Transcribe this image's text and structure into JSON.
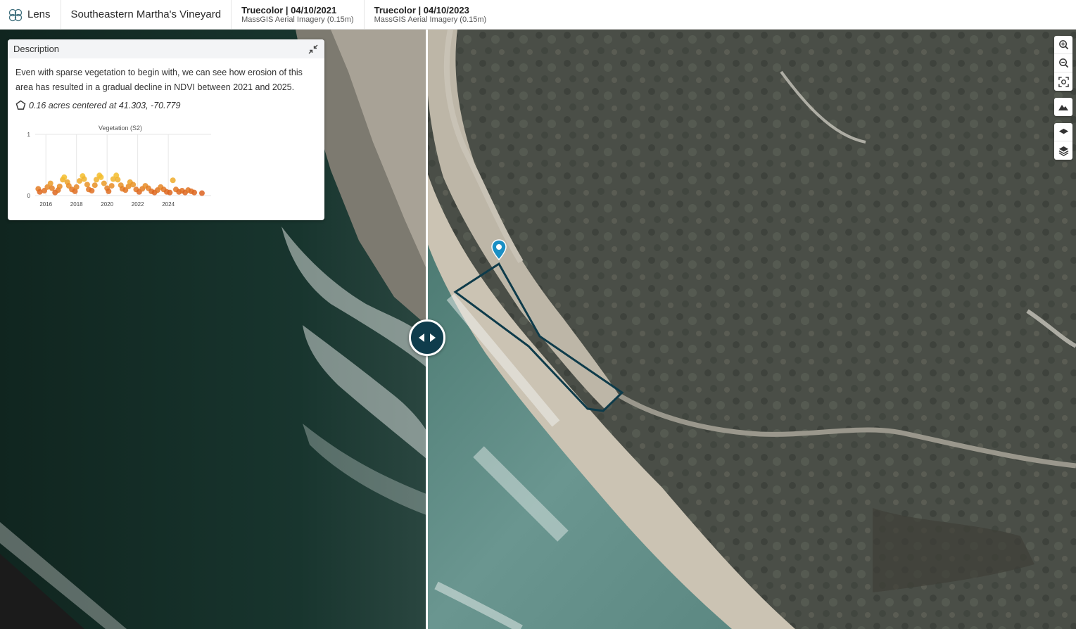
{
  "app": {
    "name": "Lens"
  },
  "project": {
    "title": "Southeastern Martha's Vineyard"
  },
  "layers": [
    {
      "title": "Truecolor | 04/10/2021",
      "source": "MassGIS Aerial Imagery (0.15m)"
    },
    {
      "title": "Truecolor | 04/10/2023",
      "source": "MassGIS Aerial Imagery (0.15m)"
    }
  ],
  "panel": {
    "title": "Description",
    "text": "Even with sparse vegetation to begin with, we can see how erosion of this area has resulted in a gradual decline in NDVI between 2021 and 2025.",
    "area_text": "0.16 acres centered at 41.303, -70.779"
  },
  "chart_data": {
    "type": "scatter",
    "title": "Vegetation (S2)",
    "xlabel": "",
    "ylabel": "",
    "x_ticks": [
      "2016",
      "2018",
      "2020",
      "2022",
      "2024"
    ],
    "y_ticks": [
      "0",
      "1"
    ],
    "xlim": [
      2015.3,
      2026.8
    ],
    "ylim": [
      0,
      1
    ],
    "grid": true,
    "points": [
      [
        2015.5,
        0.11
      ],
      [
        2015.6,
        0.06
      ],
      [
        2015.9,
        0.08
      ],
      [
        2016.1,
        0.14
      ],
      [
        2016.3,
        0.2
      ],
      [
        2016.4,
        0.12
      ],
      [
        2016.6,
        0.05
      ],
      [
        2016.8,
        0.09
      ],
      [
        2016.9,
        0.15
      ],
      [
        2017.1,
        0.26
      ],
      [
        2017.2,
        0.3
      ],
      [
        2017.4,
        0.22
      ],
      [
        2017.5,
        0.16
      ],
      [
        2017.7,
        0.1
      ],
      [
        2017.9,
        0.07
      ],
      [
        2018.0,
        0.14
      ],
      [
        2018.2,
        0.24
      ],
      [
        2018.4,
        0.32
      ],
      [
        2018.5,
        0.27
      ],
      [
        2018.7,
        0.18
      ],
      [
        2018.8,
        0.1
      ],
      [
        2019.0,
        0.08
      ],
      [
        2019.2,
        0.17
      ],
      [
        2019.3,
        0.26
      ],
      [
        2019.5,
        0.33
      ],
      [
        2019.6,
        0.3
      ],
      [
        2019.8,
        0.2
      ],
      [
        2020.0,
        0.12
      ],
      [
        2020.1,
        0.07
      ],
      [
        2020.3,
        0.16
      ],
      [
        2020.4,
        0.27
      ],
      [
        2020.6,
        0.33
      ],
      [
        2020.7,
        0.26
      ],
      [
        2020.9,
        0.17
      ],
      [
        2021.0,
        0.11
      ],
      [
        2021.2,
        0.09
      ],
      [
        2021.4,
        0.15
      ],
      [
        2021.5,
        0.22
      ],
      [
        2021.7,
        0.18
      ],
      [
        2021.9,
        0.1
      ],
      [
        2022.1,
        0.06
      ],
      [
        2022.3,
        0.11
      ],
      [
        2022.5,
        0.16
      ],
      [
        2022.7,
        0.12
      ],
      [
        2022.9,
        0.07
      ],
      [
        2023.1,
        0.05
      ],
      [
        2023.3,
        0.09
      ],
      [
        2023.5,
        0.14
      ],
      [
        2023.7,
        0.1
      ],
      [
        2023.9,
        0.06
      ],
      [
        2024.1,
        0.05
      ],
      [
        2024.3,
        0.25
      ],
      [
        2024.5,
        0.1
      ],
      [
        2024.7,
        0.06
      ],
      [
        2024.9,
        0.08
      ],
      [
        2025.1,
        0.05
      ],
      [
        2025.3,
        0.09
      ],
      [
        2025.5,
        0.07
      ],
      [
        2025.7,
        0.05
      ],
      [
        2026.2,
        0.04
      ]
    ]
  },
  "colors": {
    "accent": "#0f3c4c",
    "polygon": "#0e3b4a",
    "marker": "#1a8fc4",
    "point_low": "#d9541e",
    "point_high": "#f3bd2c"
  },
  "icons": {
    "zoom_in": "zoom-in-icon",
    "zoom_out": "zoom-out-icon",
    "fit": "fit-extent-icon",
    "terrain": "terrain-icon",
    "layer": "layer-icon",
    "layers": "layers-stack-icon",
    "swipe": "swipe-arrows-icon",
    "collapse": "collapse-icon",
    "polygon": "polygon-icon"
  }
}
